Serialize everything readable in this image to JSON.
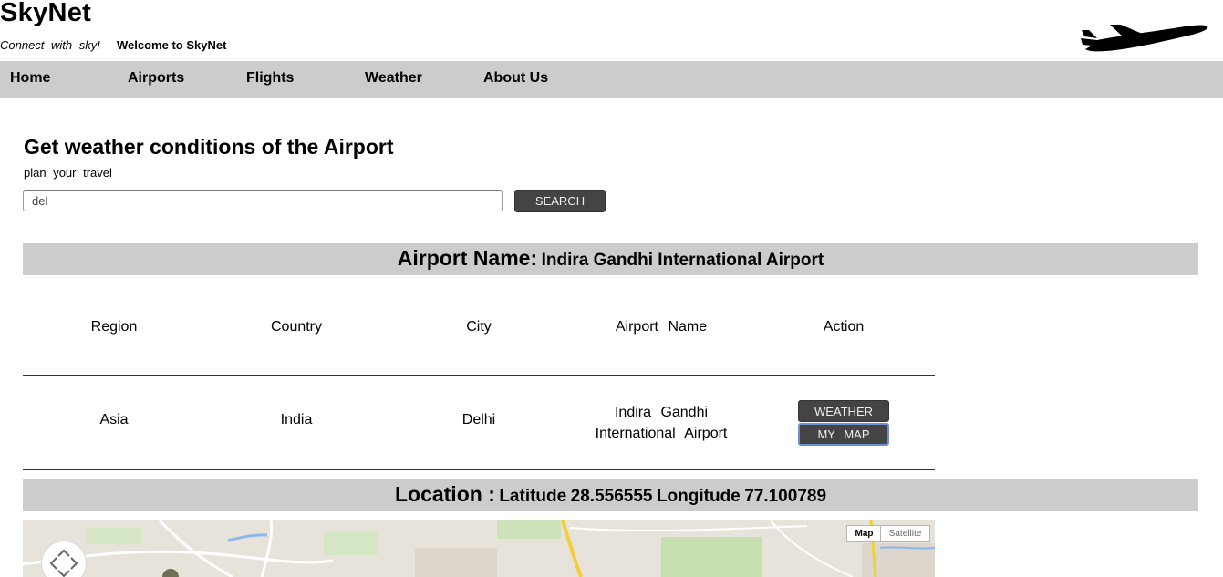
{
  "header": {
    "logo": "SkyNet",
    "tagline": "Connect with sky!",
    "welcome": "Welcome to SkyNet"
  },
  "nav": {
    "items": [
      {
        "label": "Home"
      },
      {
        "label": "Airports"
      },
      {
        "label": "Flights"
      },
      {
        "label": "Weather"
      },
      {
        "label": "About Us"
      }
    ]
  },
  "main": {
    "heading": "Get weather conditions of the Airport",
    "subheading": "plan your travel",
    "search": {
      "value": "del",
      "button": "SEARCH"
    }
  },
  "airport_band": {
    "label": "Airport Name:",
    "value": "Indira Gandhi International Airport"
  },
  "table": {
    "headers": [
      "Region",
      "Country",
      "City",
      "Airport Name",
      "Action"
    ],
    "row": {
      "region": "Asia",
      "country": "India",
      "city": "Delhi",
      "airport_line1": "Indira Gandhi",
      "airport_line2": "International Airport"
    },
    "actions": {
      "weather": "WEATHER",
      "map": "MY MAP"
    }
  },
  "location_band": {
    "label": "Location :",
    "latitude_label": "Latitude",
    "latitude": "28.556555",
    "longitude_label": "Longitude",
    "longitude": "77.100789"
  },
  "map": {
    "type_map": "Map",
    "type_satellite": "Satellite"
  },
  "colors": {
    "band_gray": "#cccccc",
    "button_dark": "#444444",
    "focus_blue": "#6b8fd0"
  }
}
